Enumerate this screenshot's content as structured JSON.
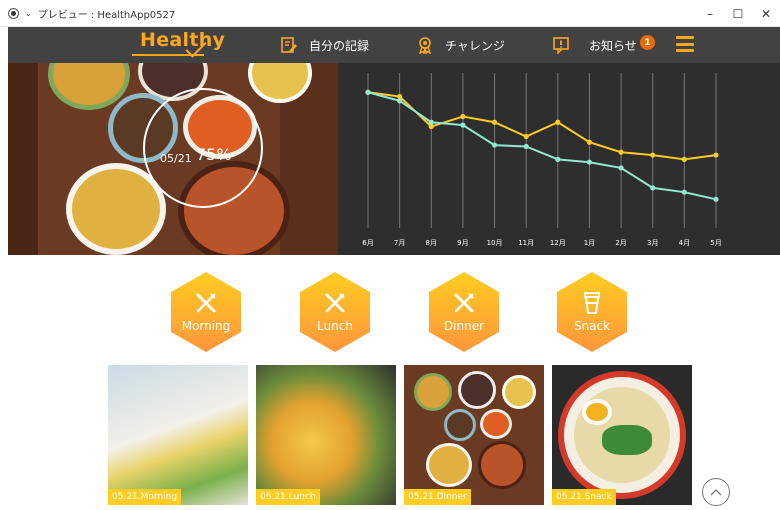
{
  "window": {
    "title": "プレビュー : HealthApp0527",
    "controls": [
      "–",
      "☐",
      "✕"
    ]
  },
  "header": {
    "logo_text": "Healthy",
    "nav": [
      {
        "label": "自分の記録",
        "icon": "memo-pencil-icon"
      },
      {
        "label": "チャレンジ",
        "icon": "medal-icon"
      },
      {
        "label": "お知らせ",
        "icon": "notice-icon"
      }
    ],
    "notification_count": "1",
    "menu_icon": "hamburger-menu-icon"
  },
  "achievement": {
    "date": "05/21",
    "rate": "75%",
    "rate_value": 75
  },
  "chart_data": {
    "type": "line",
    "categories": [
      "6月",
      "7月",
      "8月",
      "9月",
      "10月",
      "11月",
      "12月",
      "1月",
      "2月",
      "3月",
      "4月",
      "5月"
    ],
    "series": [
      {
        "color": "#ffcc21",
        "values": [
          100,
          97,
          76,
          83,
          79,
          69,
          79,
          65,
          58,
          56,
          53,
          56
        ]
      },
      {
        "color": "#8fe9d0",
        "values": [
          100,
          94,
          79,
          77,
          63,
          62,
          53,
          51,
          47,
          33,
          30,
          25
        ]
      }
    ],
    "ylim": [
      0,
      110
    ],
    "grid": "vertical",
    "title": "",
    "xlabel": "",
    "ylabel": ""
  },
  "categories": [
    {
      "label": "Morning",
      "icon": "knife-fork-icon"
    },
    {
      "label": "Lunch",
      "icon": "knife-fork-icon"
    },
    {
      "label": "Dinner",
      "icon": "knife-fork-icon"
    },
    {
      "label": "Snack",
      "icon": "cup-icon"
    }
  ],
  "meals": [
    {
      "caption": "05.21.Morning"
    },
    {
      "caption": "05.21.Lunch"
    },
    {
      "caption": "05.21.Dinner"
    },
    {
      "caption": "05.21.Snack"
    }
  ],
  "colors": {
    "primary": "#ffcc21",
    "accent": "#ffa71a",
    "header_bg": "#424242",
    "chart_bg": "#2e2e2e",
    "series_2": "#8fe9d0",
    "badge": "#ea6c00"
  }
}
